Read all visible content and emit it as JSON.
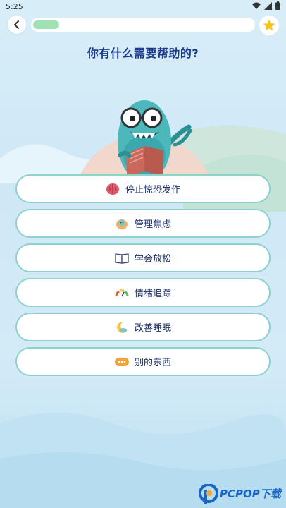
{
  "status": {
    "time": "5:25"
  },
  "header": {
    "progress_fraction": 0.12,
    "back_icon": "chevron-left-icon",
    "favorite_icon": "star-icon"
  },
  "question": "你有什么需要帮助的?",
  "options": [
    {
      "label": "停止惊恐发作",
      "icon": "brain-icon"
    },
    {
      "label": "管理焦虑",
      "icon": "anxiety-icon"
    },
    {
      "label": "学会放松",
      "icon": "book-icon"
    },
    {
      "label": "情绪追踪",
      "icon": "gauge-icon"
    },
    {
      "label": "改善睡眠",
      "icon": "moon-icon"
    },
    {
      "label": "别的东西",
      "icon": "more-icon"
    }
  ],
  "watermark": {
    "text": "PCPOP下载"
  },
  "colors": {
    "accent": "#8dd0cc",
    "title": "#1d3a8a",
    "progress": "#9ee3b1",
    "star": "#f5c518"
  }
}
